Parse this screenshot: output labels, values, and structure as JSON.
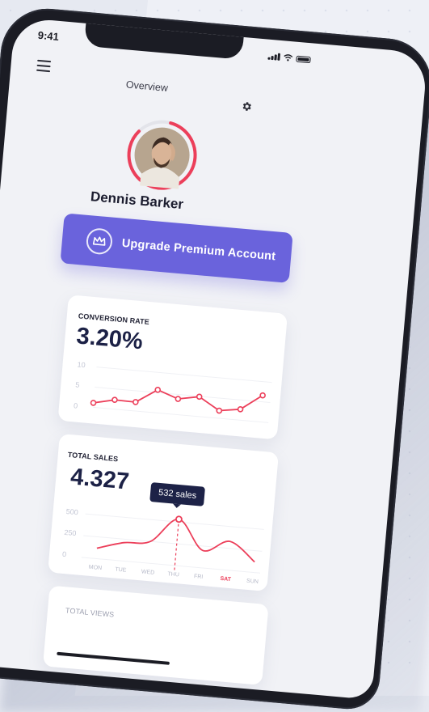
{
  "status_bar": {
    "time": "9:41"
  },
  "header": {
    "title": "Overview",
    "menu_icon": "hamburger-menu-icon",
    "settings_icon": "gear-icon"
  },
  "profile": {
    "name": "Dennis Barker",
    "avatar": "user-avatar",
    "ring_color": "#ec3f5a"
  },
  "upgrade_button": {
    "label": "Upgrade Premium Account",
    "icon": "crown-icon",
    "color": "#6a63dc"
  },
  "conversion_card": {
    "label": "CONVERSION RATE",
    "value": "3.20%",
    "y_ticks": [
      "10",
      "5",
      "0"
    ]
  },
  "sales_card": {
    "label": "TOTAL SALES",
    "value": "4.327",
    "y_ticks": [
      "500",
      "250",
      "0"
    ],
    "x_ticks": [
      "MON",
      "TUE",
      "WED",
      "THU",
      "FRI",
      "SAT",
      "SUN"
    ],
    "active_day": "SAT",
    "tooltip": "532 sales"
  },
  "views_card": {
    "label": "TOTAL VIEWS"
  },
  "accent_color": "#ec3f5a",
  "chart_data": [
    {
      "type": "line",
      "ylabel": "",
      "ylim": [
        0,
        10
      ],
      "x": [
        1,
        2,
        3,
        4,
        5,
        6,
        7,
        8,
        9
      ],
      "values": [
        1.1,
        2.3,
        2.2,
        5.7,
        3.9,
        4.9,
        1.9,
        2.7,
        6.6
      ]
    },
    {
      "type": "line",
      "ylim": [
        0,
        500
      ],
      "categories": [
        "MON",
        "TUE",
        "WED",
        "THU",
        "FRI",
        "SAT",
        "SUN"
      ],
      "values": [
        120,
        210,
        250,
        532,
        200,
        330,
        120
      ]
    }
  ]
}
